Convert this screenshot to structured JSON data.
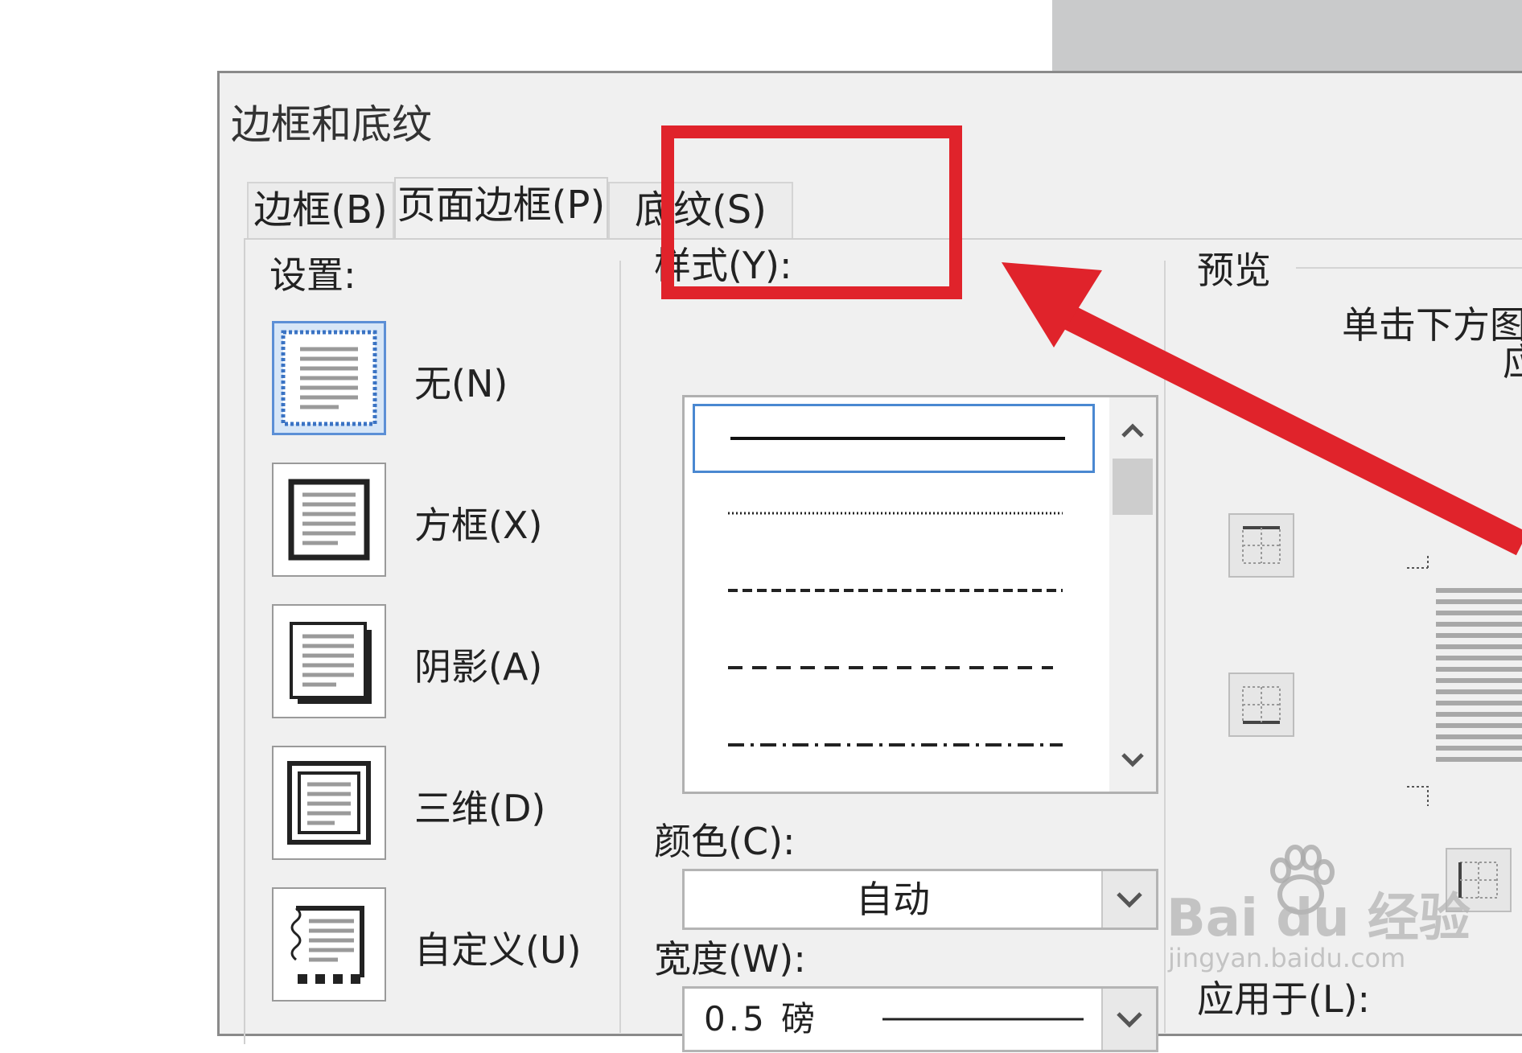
{
  "dialog": {
    "title": "边框和底纹"
  },
  "tabs": [
    {
      "label": "边框(B)",
      "active": false
    },
    {
      "label": "页面边框(P)",
      "active": true
    },
    {
      "label": "底纹(S)",
      "active": false
    }
  ],
  "settings": {
    "heading": "设置:",
    "items": [
      {
        "label": "无(N)",
        "icon": "setting-none-icon",
        "selected": true
      },
      {
        "label": "方框(X)",
        "icon": "setting-box-icon"
      },
      {
        "label": "阴影(A)",
        "icon": "setting-shadow-icon"
      },
      {
        "label": "三维(D)",
        "icon": "setting-3d-icon"
      },
      {
        "label": "自定义(U)",
        "icon": "setting-custom-icon"
      }
    ]
  },
  "style": {
    "heading": "样式(Y):",
    "options": [
      "solid",
      "dotted",
      "dashed-small",
      "dashed-large",
      "dash-dot"
    ]
  },
  "color": {
    "label": "颜色(C):",
    "value": "自动"
  },
  "width": {
    "label": "宽度(W):",
    "value": "0.5 磅"
  },
  "preview": {
    "heading": "预览",
    "hint_line1": "单击下方图",
    "hint_line2": "应"
  },
  "apply_to": {
    "label": "应用于(L):"
  },
  "watermark": {
    "brand": "Bai du 经验",
    "url": "jingyan.baidu.com"
  },
  "colors": {
    "accent": "#4a88d1",
    "annotation": "#e0232b"
  }
}
